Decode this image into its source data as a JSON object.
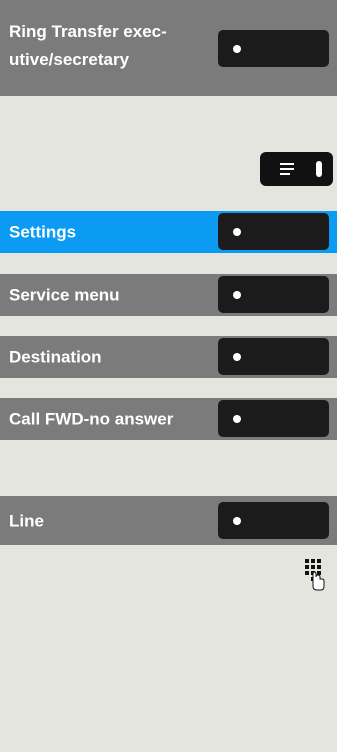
{
  "rows": [
    {
      "label": "Ring Transfer exec-utive/secretary"
    },
    {
      "label": "Settings",
      "selected": true
    },
    {
      "label": "Service menu"
    },
    {
      "label": "Destination"
    },
    {
      "label": "Call FWD-no answer"
    },
    {
      "label": "Line"
    }
  ],
  "icons": {
    "menu_key": "menu-key-icon",
    "keypad": "keypad-icon"
  },
  "colors": {
    "background": "#e5e5e0",
    "row_gray": "#7b7b7b",
    "row_selected": "#0b9bf2",
    "key_dark": "#1b1b1b"
  }
}
